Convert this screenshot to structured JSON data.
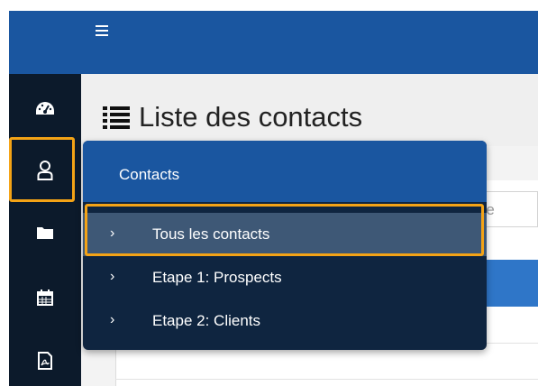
{
  "header": {
    "menu_icon": "hamburger-icon"
  },
  "sidebar": {
    "items": [
      {
        "icon": "dashboard-gauge-icon"
      },
      {
        "icon": "user-icon",
        "highlighted": true
      },
      {
        "icon": "folder-icon"
      },
      {
        "icon": "calendar-icon"
      },
      {
        "icon": "pdf-file-icon"
      }
    ]
  },
  "page": {
    "title": "Liste des contacts",
    "title_icon": "list-icon"
  },
  "search": {
    "visible_text": "naire"
  },
  "submenu": {
    "title": "Contacts",
    "items": [
      {
        "label": "Tous les contacts",
        "active": true
      },
      {
        "label": "Etape 1: Prospects"
      },
      {
        "label": "Etape 2: Clients"
      }
    ]
  },
  "colors": {
    "topbar": "#1a56a0",
    "sidebar": "#0c1a2b",
    "submenu_bg": "#0f2540",
    "active_item": "#3e5876",
    "highlight": "#f4a316"
  }
}
